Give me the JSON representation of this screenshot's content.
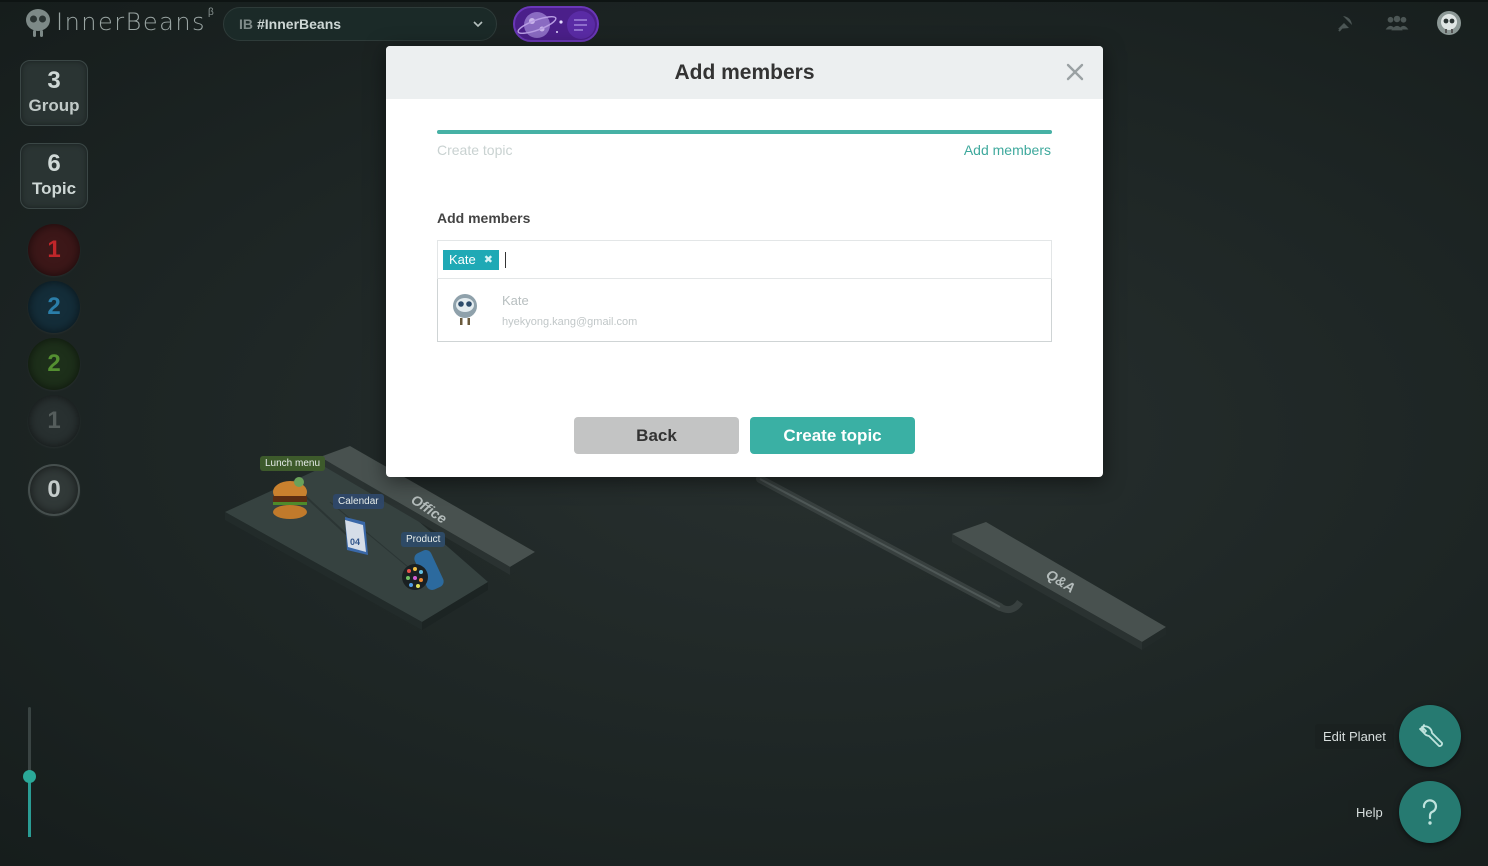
{
  "app": {
    "logo_text": "InnerBeans",
    "logo_superscript": "β"
  },
  "planet_selector": {
    "prefix": "IB",
    "name": "#InnerBeans"
  },
  "sidebar": {
    "group": {
      "count": "3",
      "label": "Group"
    },
    "topic": {
      "count": "6",
      "label": "Topic"
    },
    "badges": [
      {
        "value": "1",
        "color": "#d22b2b",
        "bg": "#4a1a1a"
      },
      {
        "value": "2",
        "color": "#2f86b4",
        "bg": "#14303c"
      },
      {
        "value": "2",
        "color": "#5c9a36",
        "bg": "#1f321c"
      },
      {
        "value": "1",
        "color": "#5f6766",
        "bg": "#2b3332"
      },
      {
        "value": "0",
        "color": "#c9d0cf",
        "bg": "#333b3a"
      }
    ]
  },
  "zoom": {
    "level": 0.46
  },
  "scene": {
    "labels": {
      "lunch": "Lunch menu",
      "calendar": "Calendar",
      "product": "Product",
      "office": "Office",
      "qa": "Q&A"
    }
  },
  "fabs": {
    "edit_planet": "Edit Planet",
    "help": "Help"
  },
  "modal": {
    "title": "Add members",
    "progress": 1.0,
    "step_left": "Create topic",
    "step_right": "Add members",
    "section_label": "Add members",
    "chips": [
      {
        "label": "Kate"
      }
    ],
    "suggestion": {
      "name": "Kate",
      "email": "hyekyong.kang@gmail.com"
    },
    "back_label": "Back",
    "create_label": "Create topic"
  },
  "colors": {
    "accent": "#3ab0a4",
    "chip": "#1fa9b5",
    "fab": "#267a71"
  }
}
